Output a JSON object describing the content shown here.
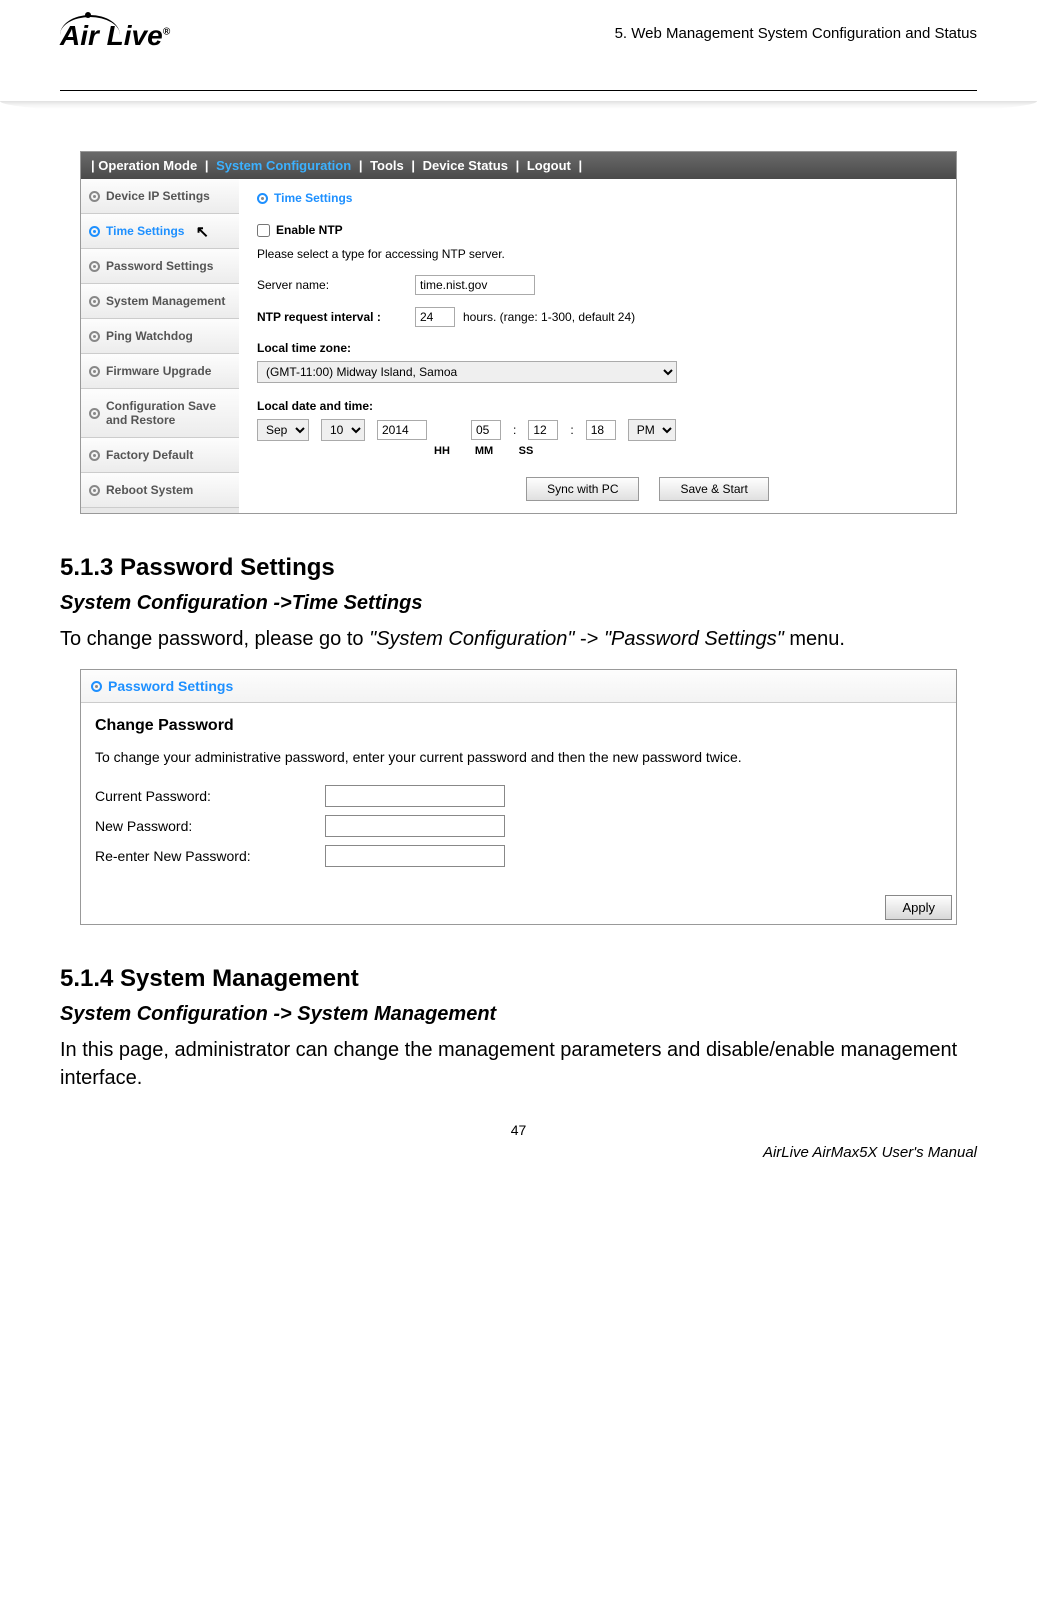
{
  "header": {
    "logo_text": "Air Live",
    "chapter": "5. Web Management System Configuration and Status"
  },
  "sshot1": {
    "topbar": {
      "sep": "|",
      "items": [
        "Operation Mode",
        "System Configuration",
        "Tools",
        "Device Status",
        "Logout"
      ],
      "active_index": 1
    },
    "sidebar": {
      "items": [
        "Device IP Settings",
        "Time Settings",
        "Password Settings",
        "System Management",
        "Ping Watchdog",
        "Firmware Upgrade",
        "Configuration Save and Restore",
        "Factory Default",
        "Reboot System"
      ],
      "active_index": 1
    },
    "main": {
      "title": "Time Settings",
      "enable_ntp_label": "Enable NTP",
      "enable_ntp_checked": false,
      "hint": "Please select a type for accessing NTP server.",
      "server_name_label": "Server name:",
      "server_name_value": "time.nist.gov",
      "interval_label": "NTP request interval :",
      "interval_value": "24",
      "interval_suffix": "hours. (range: 1-300, default 24)",
      "tz_label": "Local time zone:",
      "tz_value": "(GMT-11:00) Midway Island, Samoa",
      "dt_label": "Local date and time:",
      "month": "Sep",
      "day": "10",
      "year": "2014",
      "hh": "05",
      "mm": "12",
      "ss": "18",
      "ampm": "PM",
      "hh_lbl": "HH",
      "mm_lbl": "MM",
      "ss_lbl": "SS",
      "colon": ":",
      "sync_btn": "Sync with PC",
      "save_btn": "Save & Start"
    }
  },
  "section1": {
    "heading": "5.1.3 Password Settings",
    "breadcrumb": "System Configuration ->Time Settings",
    "para_pre": "To change password, please go to ",
    "para_ital1": "\"System Configuration\"",
    "para_mid": " -> ",
    "para_ital2": "\"Password Settings\"",
    "para_post": " menu."
  },
  "sshot2": {
    "title": "Password Settings",
    "heading": "Change Password",
    "info": "To change your administrative password, enter your current password and then the new password twice.",
    "current_label": "Current Password:",
    "new_label": "New Password:",
    "re_label": "Re-enter New Password:",
    "apply": "Apply"
  },
  "section2": {
    "heading": "5.1.4 System Management",
    "breadcrumb": "System Configuration -> System Management",
    "para": "In this page, administrator can change the management parameters and disable/enable management interface."
  },
  "footer": {
    "page": "47",
    "manual": "AirLive AirMax5X User's Manual"
  }
}
